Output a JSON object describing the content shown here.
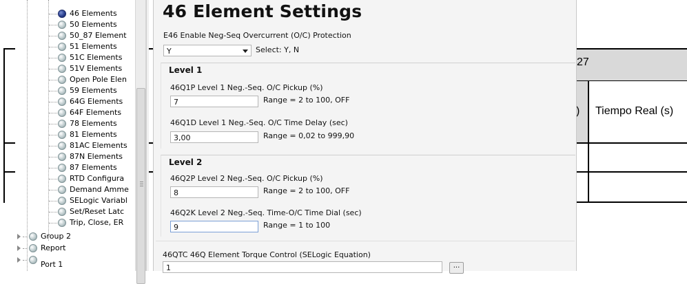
{
  "settings": {
    "title": "46 Element Settings",
    "e46_label": "E46  Enable Neg-Seq Overcurrent (O/C) Protection",
    "e46_value": "Y",
    "e46_hint": "Select: Y, N",
    "level1_title": "Level 1",
    "q1p_label": "46Q1P  Level 1 Neg.-Seq. O/C Pickup (%)",
    "q1p_value": "7",
    "q1p_range": "Range = 2 to 100, OFF",
    "q1d_label": "46Q1D  Level 1 Neg.-Seq. O/C Time Delay (sec)",
    "q1d_value": "3,00",
    "q1d_range": "Range = 0,02 to 999,90",
    "level2_title": "Level 2",
    "q2p_label": "46Q2P  Level 2 Neg.-Seq. O/C Pickup (%)",
    "q2p_value": "8",
    "q2p_range": "Range = 2 to 100, OFF",
    "q2k_label": "46Q2K  Level 2 Neg.-Seq. Time-O/C Time Dial (sec)",
    "q2k_value": "9",
    "q2k_range": "Range = 1 to 100",
    "qtc_label": "46QTC  46Q Element Torque Control (SELogic Equation)",
    "qtc_value": "1",
    "ellipsis_label": "..."
  },
  "tree": {
    "items": [
      {
        "label": "46 Elements",
        "active": true
      },
      {
        "label": "50 Elements"
      },
      {
        "label": "50_87 Element"
      },
      {
        "label": "51 Elements"
      },
      {
        "label": "51C Elements"
      },
      {
        "label": "51V Elements"
      },
      {
        "label": "Open Pole Elen"
      },
      {
        "label": "59 Elements"
      },
      {
        "label": "64G Elements"
      },
      {
        "label": "64F Elements"
      },
      {
        "label": "78 Elements"
      },
      {
        "label": "81 Elements"
      },
      {
        "label": "81AC Elements"
      },
      {
        "label": "87N Elements"
      },
      {
        "label": "87 Elements"
      },
      {
        "label": "RTD Configura"
      },
      {
        "label": "Demand Amme"
      },
      {
        "label": "SELogic Variabl"
      },
      {
        "label": "Set/Reset Latc"
      },
      {
        "label": "Trip, Close, ER"
      }
    ],
    "groups": [
      "Group 2",
      "Report",
      "Port 1"
    ]
  },
  "background_doc": {
    "header_partial": "27",
    "col_partial": ")",
    "col_header": "Tiempo Real (s)"
  },
  "colors": {
    "accent": "#2a3f8f",
    "panel_bg": "#f4f4f4",
    "table_header_bg": "#d9d9d9"
  }
}
